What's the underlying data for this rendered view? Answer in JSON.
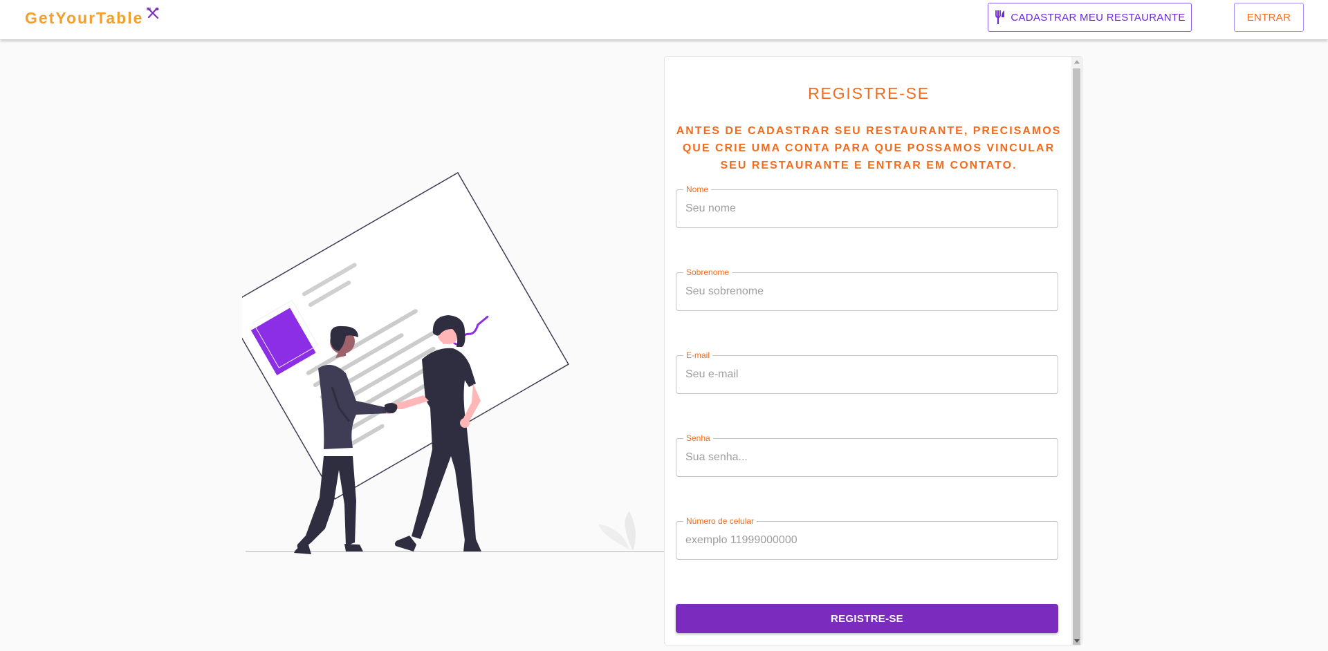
{
  "header": {
    "brand": "GetYourTable",
    "brand_icon": "utensils-crossed-icon",
    "register_restaurant_label": "CADASTRAR MEU RESTAURANTE",
    "register_restaurant_icon": "fork-knife-icon",
    "login_label": "ENTRAR"
  },
  "form": {
    "title": "REGISTRE-SE",
    "subtitle": "ANTES DE CADASTRAR SEU RESTAURANTE, PRECISAMOS QUE CRIE UMA CONTA PARA QUE POSSAMOS VINCULAR SEU RESTAURANTE E ENTRAR EM CONTATO.",
    "fields": [
      {
        "label": "Nome",
        "placeholder": "Seu nome",
        "value": ""
      },
      {
        "label": "Sobrenome",
        "placeholder": "Seu sobrenome",
        "value": ""
      },
      {
        "label": "E-mail",
        "placeholder": "Seu e-mail",
        "value": ""
      },
      {
        "label": "Senha",
        "placeholder": "Sua senha...",
        "value": ""
      },
      {
        "label": "Número de celular",
        "placeholder": "exemplo 11999000000",
        "value": ""
      }
    ],
    "submit_label": "REGISTRE-SE"
  },
  "colors": {
    "brand": "#f59f2a",
    "accent_orange": "#f26b1d",
    "accent_purple": "#7b2cbf",
    "illustration_purple": "#8b2ee6",
    "figure_dark": "#2f2e41"
  },
  "illustration": "handshake-contract-illustration"
}
